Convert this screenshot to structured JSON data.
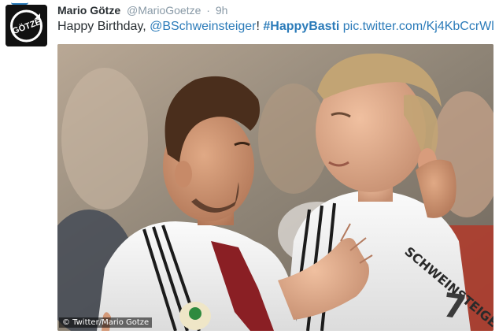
{
  "tweet": {
    "author_name": "Mario Götze",
    "handle": "@MarioGoetze",
    "separator": "·",
    "time": "9h",
    "text_prefix": "Happy Birthday, ",
    "mention": "@BSchweinsteiger",
    "text_mid": "! ",
    "hashtag": "#HappyBasti",
    "pic_link": "pic.twitter.com/Kj4KbCcrWl",
    "avatar_logo_text": "GÖTZE",
    "avatar_icon": "goetze-logo-icon"
  },
  "photo": {
    "jersey_name": "SCHWEINSTEIGER",
    "jersey_number": "7",
    "watermark": "© Twitter/Mario Gotze"
  },
  "colors": {
    "link": "#2b7bb9",
    "text": "#292f33",
    "muted": "#8899a6",
    "avatar_bg": "#111111"
  }
}
